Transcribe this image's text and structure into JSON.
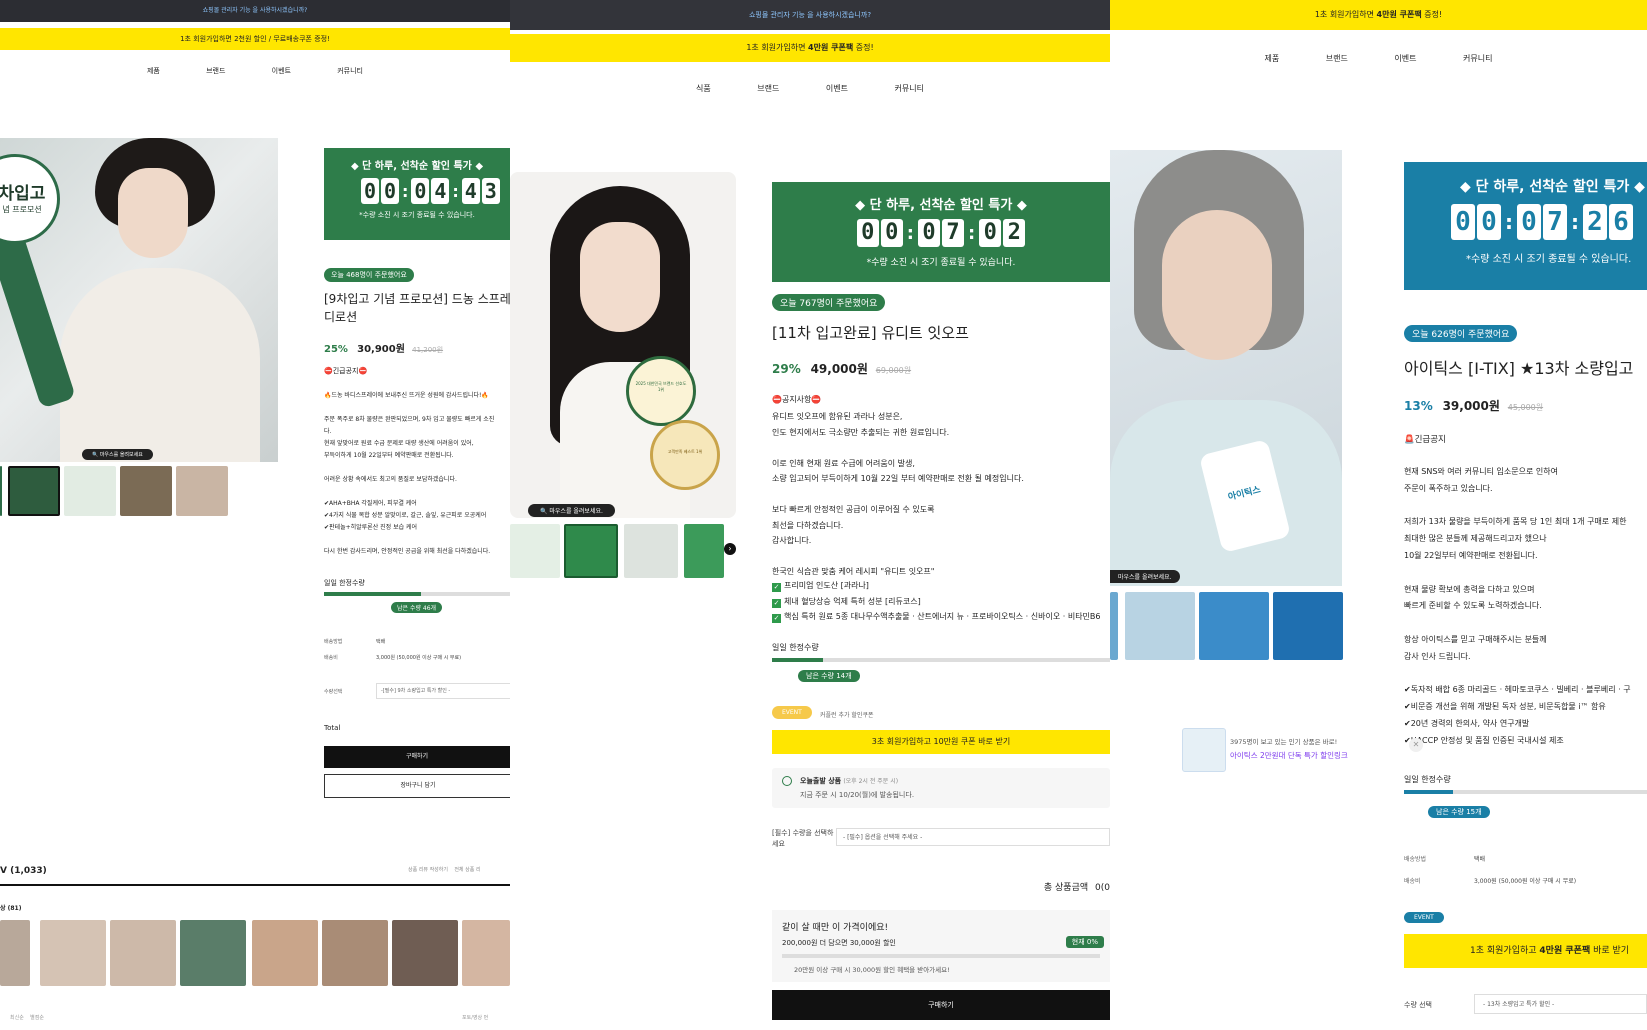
{
  "p1": {
    "topbar": "쇼핑몰 관리자 기능 을 사용하시겠습니까?",
    "promo": "1초 회원가입하면 2천원 할인 / 무료배송쿠폰 증정!",
    "nav": [
      "제품",
      "브랜드",
      "이벤트",
      "커뮤니티"
    ],
    "banner_big": "차입고",
    "banner_small": "념 프로모션",
    "timer_title": "◆ 단 하루, 선착순 할인 특가 ◆",
    "timer_digits": [
      "0",
      "0",
      "0",
      "4",
      "4",
      "3"
    ],
    "timer_note": "*수량 소진 시 조기 종료될 수 있습니다.",
    "order_badge": "오늘 468명이 주문했어요",
    "title_line1": "[9차입고 기념 프로모션] 드농 스프레",
    "title_line2": "디로션",
    "discount": "25%",
    "price": "30,900원",
    "orig_price": "41,200원",
    "notice": "⛔긴급공지⛔",
    "body": [
      "🔥드농 바디스프레이에 보내주신 뜨거운 성원에 감사드립니다!🔥",
      "",
      "주문 폭주로 8차 물량은 완판되었으며, 9차 입고 물량도 빠르게 소진",
      "다.",
      "현재 앞맞어로 원료 수급 문제로 대량 생산에 어려움이 있어,",
      "부득이하게 10월 22일부터 예약판매로 전환됩니다.",
      "",
      "어려운 상황 속에서도 최고의 품질로 보답하겠습니다.",
      "",
      "✔AHA+BHA 각질케어, 피부결 케어",
      "✔4가지 식물 복합 성분 알맞이로, 갈근, 솔잎, 유근피로 오공케어",
      "✔판테놀+히알루론산 진정 보습 케어",
      "",
      "다시 한번 감사드리며, 안정적인 공급을 위해 최선을 다하겠습니다."
    ],
    "limit_label": "일일 한정수량",
    "remain": "남은 수량 46개",
    "ship_method_label": "배송방법",
    "ship_method": "택배",
    "ship_fee_label": "배송비",
    "ship_fee": "3,000원 (50,000원 이상 구매 시 무료)",
    "qty_label": "수량선택",
    "qty_value": "-[필수] 9차 소량입고 특가 할인 -",
    "total_label": "Total",
    "buy": "구매하기",
    "cart": "장바구니 담기",
    "hover_hint": "마우스를 올려보세요",
    "review_title": "V (1,033)",
    "review_links": "상품 리뷰 작성하기    전체 상품 리",
    "review_count": "상 (81)",
    "footer_left": "최신순    별점순",
    "footer_right": "포토/영상 먼"
  },
  "p2": {
    "topbar": "쇼핑몰 관리자 기능 을 사용하시겠습니까?",
    "promo_pre": "1초 회원가입하면 ",
    "promo_bold": "4만원 쿠폰팩",
    "promo_post": " 증정!",
    "nav": [
      "식품",
      "브랜드",
      "이벤트",
      "커뮤니티"
    ],
    "timer_title": "◆ 단 하루, 선착순 할인 특가 ◆",
    "timer_digits": [
      "0",
      "0",
      "0",
      "7",
      "0",
      "2"
    ],
    "timer_note": "*수량 소진 시 조기 종료될 수 있습니다.",
    "order_badge": "오늘 767명이 주문했어요",
    "title": "[11차 입고완료] 유디트 잇오프",
    "discount": "29%",
    "price": "49,000원",
    "orig_price": "69,000원",
    "notice": "⛔공지사항⛔",
    "body": [
      "유디트 잇오프에 함유된 과라나 성분은,",
      "인도 현지에서도 극소량만 추출되는 귀한 원료입니다.",
      "",
      "이로 인해 현재 원료 수급에 어려움이 발생,",
      "소량 입고되어 부득이하게 10월 22일 부터 예약판매로 전환 될 예정입니다.",
      "",
      "보다 빠르게 안정적인 공급이 이루어질 수 있도록",
      "최선을 다하겠습니다.",
      "감사합니다.",
      "",
      "한국인 식습관 맞춤 케어 레시피 \"유디트 잇오프\""
    ],
    "checks": [
      "프리미엄 인도산 [과라나]",
      "체내 혈당상승 억제 특허 성분 [리듀코스]",
      "핵심 특허 원료 5종 대나무수액추출물 · 산트에너지 뉴 · 프로바이오틱스 · 신바이오 · 비타민B6"
    ],
    "limit_label": "일일 한정수량",
    "remain": "남은 수량 14개",
    "event_badge": "EVENT",
    "event_text": "커플런 추가 할인쿠폰",
    "signup_btn": "3초 회원가입하고 10만원 쿠폰 바로 받기",
    "ship_title": "오늘출발 상품",
    "ship_time": "(오후 2시 전 주문 시)",
    "ship_desc": "지금 주문 시 10/20(월)에 발송됩니다.",
    "req_label": "[필수] 수량을 선택하세요",
    "req_value": "- [필수] 옵션을 선택해 주세요 -",
    "total_label": "총 상품금액",
    "total_value": "0(0",
    "bundle_title": "같이 살 때만 이 가격이에요!",
    "bundle_desc": "200,000원 더 담으면 30,000원 할인",
    "bundle_badge": "현재 0%",
    "bundle_note": "20만원 이상 구매 시 30,000원 할인 혜택을 받아가세요!",
    "buy": "구매하기",
    "hover_hint": "마우스를 올려보세요.",
    "award_year": "2025 대한민국 브랜드 선호도 1위",
    "award2": "고객만족 베스트 1위"
  },
  "p3": {
    "promo_pre": "1초 회원가입하면 ",
    "promo_bold": "4만원 쿠폰팩",
    "promo_post": " 증정!",
    "nav": [
      "제품",
      "브랜드",
      "이벤트",
      "커뮤니티"
    ],
    "timer_title": "◆ 단 하루, 선착순 할인 특가 ◆",
    "timer_digits": [
      "0",
      "0",
      "0",
      "7",
      "2",
      "6"
    ],
    "timer_note": "*수량 소진 시 조기 종료될 수 있습니다.",
    "order_badge": "오늘 626명이 주문했어요",
    "title": "아이틱스 [I-TIX] ★13차 소량입고",
    "discount": "13%",
    "price": "39,000원",
    "orig_price": "45,000원",
    "notice": "🚨긴급공지",
    "body": [
      "현재 SNS와 여러 커뮤니티 입소문으로 인하여",
      "주문이 폭주하고 있습니다.",
      "",
      "저희가 13차 물량을 부득이하게 품목 당 1인 최대 1개 구매로 제한",
      "최대한 많은 분들께 제공해드리고자 했으나",
      "10월 22일부터 예약판매로 전환됩니다.",
      "",
      "현재 물량 확보에 총력을 다하고 있으며",
      "빠르게 준비할 수 있도록 노력하겠습니다.",
      "",
      "항상 아이틱스를 믿고 구매해주시는 분들께",
      "감사 인사 드립니다.",
      "",
      "✔독자적 배합 6종 마리골드 · 헤마토코쿠스 · 빌베리 · 블루베리 · 구",
      "✔비문증 개선을 위해 개발된 독자 성분, 비문독합물 i™ 함유",
      "✔20년 경력의 한의사, 약사 연구개발",
      "✔HACCP 안정성 및 품질 인증된 국내시설 제조"
    ],
    "limit_label": "일일 한정수량",
    "remain": "남은 수량 15개",
    "ship_method_label": "배송방법",
    "ship_method": "택배",
    "ship_fee_label": "배송비",
    "ship_fee": "3,000원 (50,000원 이상 구매 시 무료)",
    "event_badge": "EVENT",
    "signup_pre": "1초 회원가입하고 ",
    "signup_bold": "4만원 쿠폰팩",
    "signup_post": " 바로 받기",
    "qty_label": "수량 선택",
    "qty_value": "- 13차 소량입고 특가 할인 -",
    "popup_count": "3975명이 보고 있는 인기 상품은 바로!",
    "popup_link": "아이틱스 2만원대 단독 특가 할인링크",
    "popup_close": "✕",
    "hover_hint": "마우스를 올려보세요.",
    "product_label": "아이틱스"
  },
  "colors": {
    "green": "#2e7d4a",
    "blue": "#1a7fa6",
    "yellow": "#ffe600",
    "dark": "#33343a"
  }
}
